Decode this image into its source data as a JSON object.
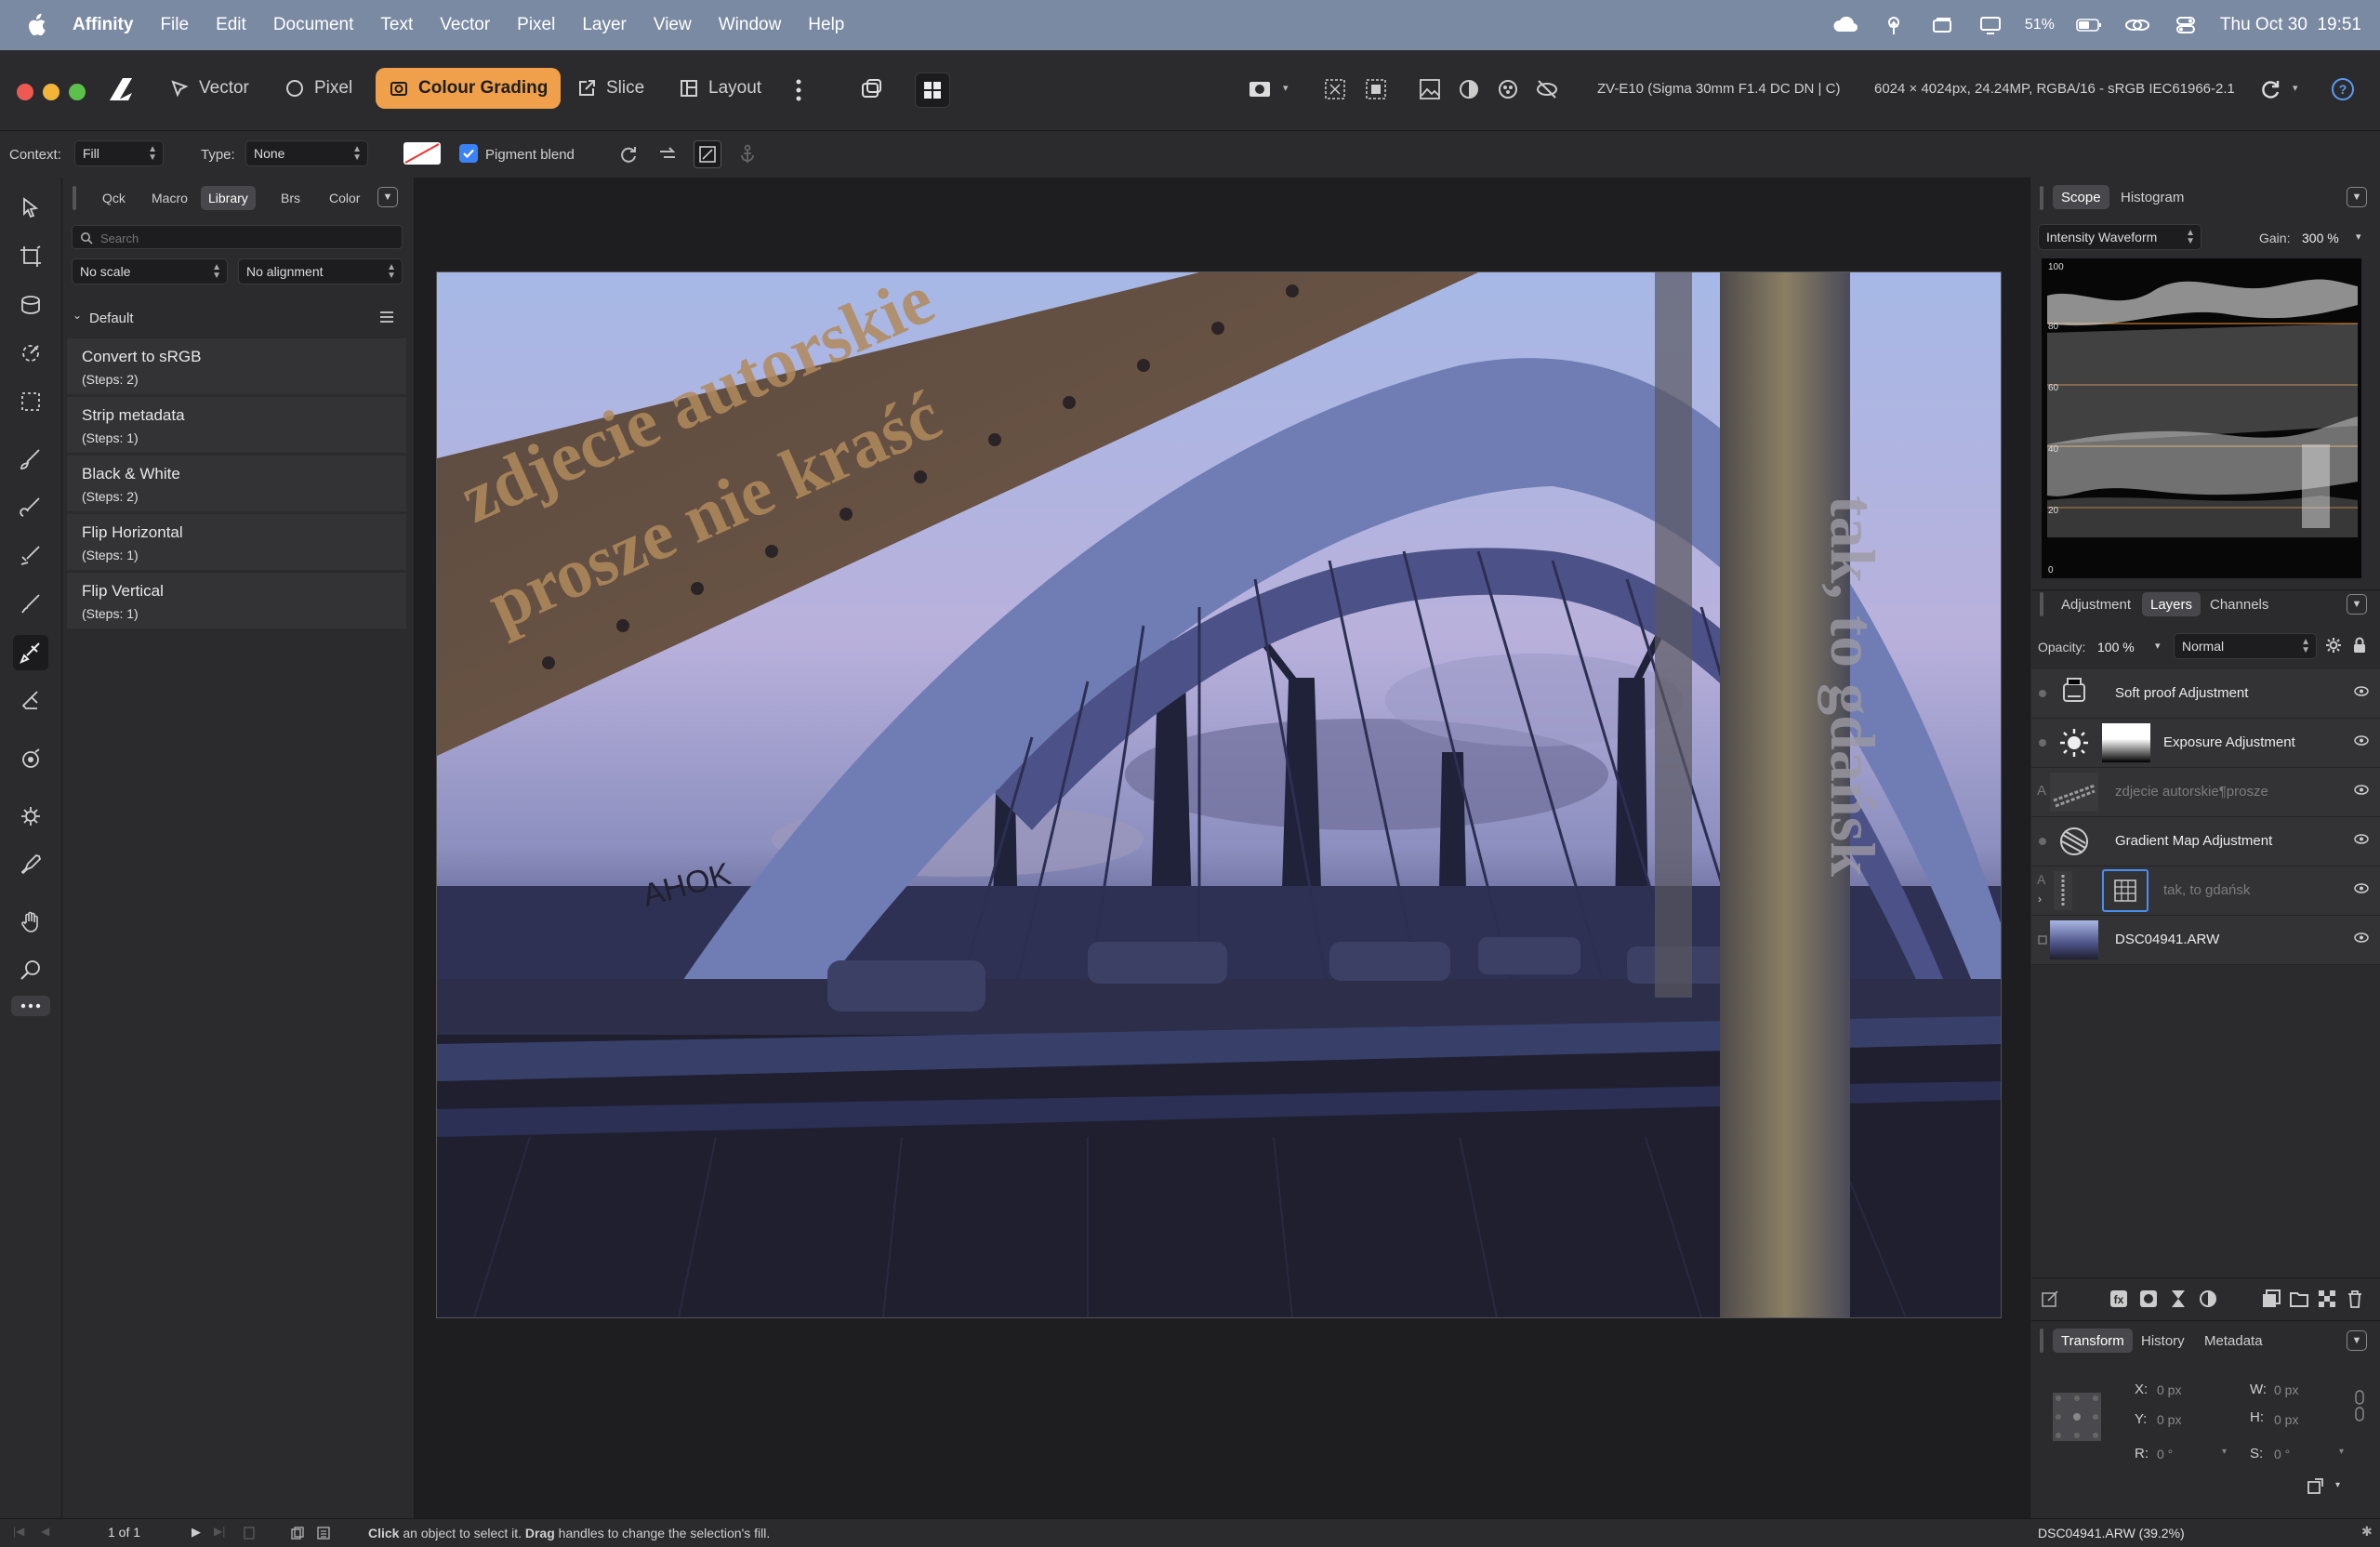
{
  "menubar": {
    "app_name": "Affinity",
    "menus": [
      "File",
      "Edit",
      "Document",
      "Text",
      "Vector",
      "Pixel",
      "Layer",
      "View",
      "Window",
      "Help"
    ],
    "battery": "51%",
    "datetime": "Thu Oct 30  19:51"
  },
  "toolbar": {
    "personas": [
      {
        "label": "Vector",
        "icon": "vector-persona-icon"
      },
      {
        "label": "Pixel",
        "icon": "pixel-persona-icon"
      },
      {
        "label": "Colour Grading",
        "icon": "colour-grading-icon",
        "active": true
      },
      {
        "label": "Slice",
        "icon": "slice-icon"
      },
      {
        "label": "Layout",
        "icon": "layout-icon"
      }
    ],
    "camera_info": "ZV-E10 (Sigma 30mm F1.4 DC DN | C)",
    "document_info": "6024 × 4024px, 24.24MP, RGBA/16 - sRGB IEC61966-2.1"
  },
  "context": {
    "context_label": "Context:",
    "context_value": "Fill",
    "type_label": "Type:",
    "type_value": "None",
    "pigment_blend_label": "Pigment blend",
    "pigment_blend_checked": true
  },
  "library": {
    "tabs": [
      "Qck",
      "Macro",
      "Library",
      "Brs",
      "Color"
    ],
    "active_tab": "Library",
    "search_placeholder": "Search",
    "scale_value": "No scale",
    "alignment_value": "No alignment",
    "category": "Default",
    "macros": [
      {
        "name": "Convert to sRGB",
        "steps": "(Steps: 2)"
      },
      {
        "name": "Strip metadata",
        "steps": "(Steps: 1)"
      },
      {
        "name": "Black & White",
        "steps": "(Steps: 2)"
      },
      {
        "name": "Flip Horizontal",
        "steps": "(Steps: 1)"
      },
      {
        "name": "Flip Vertical",
        "steps": "(Steps: 1)"
      }
    ]
  },
  "photo": {
    "watermark_line1": "zdjecie autorskie",
    "watermark_line2": "prosze nie kraść",
    "vertical_text": "tak, to gdańsk",
    "graffiti": "AHOK"
  },
  "scope": {
    "tabs": [
      "Scope",
      "Histogram"
    ],
    "active_tab": "Scope",
    "mode": "Intensity Waveform",
    "gain_label": "Gain:",
    "gain_value": "300 %",
    "ticks": [
      "100",
      "80",
      "60",
      "40",
      "20",
      "0"
    ]
  },
  "layers_panel": {
    "tabs": [
      "Adjustment",
      "Layers",
      "Channels"
    ],
    "active_tab": "Layers",
    "opacity_label": "Opacity:",
    "opacity_value": "100 %",
    "blend_mode": "Normal",
    "layers": [
      {
        "name": "Soft proof Adjustment",
        "icon": "soft-proof-icon",
        "dim": false
      },
      {
        "name": "Exposure Adjustment",
        "icon": "exposure-icon",
        "dim": false
      },
      {
        "name": "zdjecie autorskie¶prosze",
        "icon": "text-layer-icon",
        "dim": true
      },
      {
        "name": "Gradient Map Adjustment",
        "icon": "gradient-map-icon",
        "dim": false
      },
      {
        "name": "tak, to gdańsk",
        "icon": "text-layer-icon",
        "dim": true
      },
      {
        "name": "DSC04941.ARW",
        "icon": "image-layer-icon",
        "dim": false
      }
    ]
  },
  "transform": {
    "tabs": [
      "Transform",
      "History",
      "Metadata"
    ],
    "active_tab": "Transform",
    "x_label": "X:",
    "x_value": "0 px",
    "y_label": "Y:",
    "y_value": "0 px",
    "w_label": "W:",
    "w_value": "0 px",
    "h_label": "H:",
    "h_value": "0 px",
    "r_label": "R:",
    "r_value": "0 °",
    "s_label": "S:",
    "s_value": "0 °"
  },
  "status": {
    "page": "1 of 1",
    "hint_click": "Click",
    "hint_1": " an object to select it. ",
    "hint_drag": "Drag",
    "hint_2": " handles to change the selection's fill.",
    "file_info": "DSC04941.ARW (39.2%)"
  },
  "colors": {
    "accent": "#f0a04a",
    "menubar": "#7b8aa3",
    "panel": "#2b2b2e",
    "scope_line": "#c87a2a",
    "checkbox": "#3a82f6"
  }
}
